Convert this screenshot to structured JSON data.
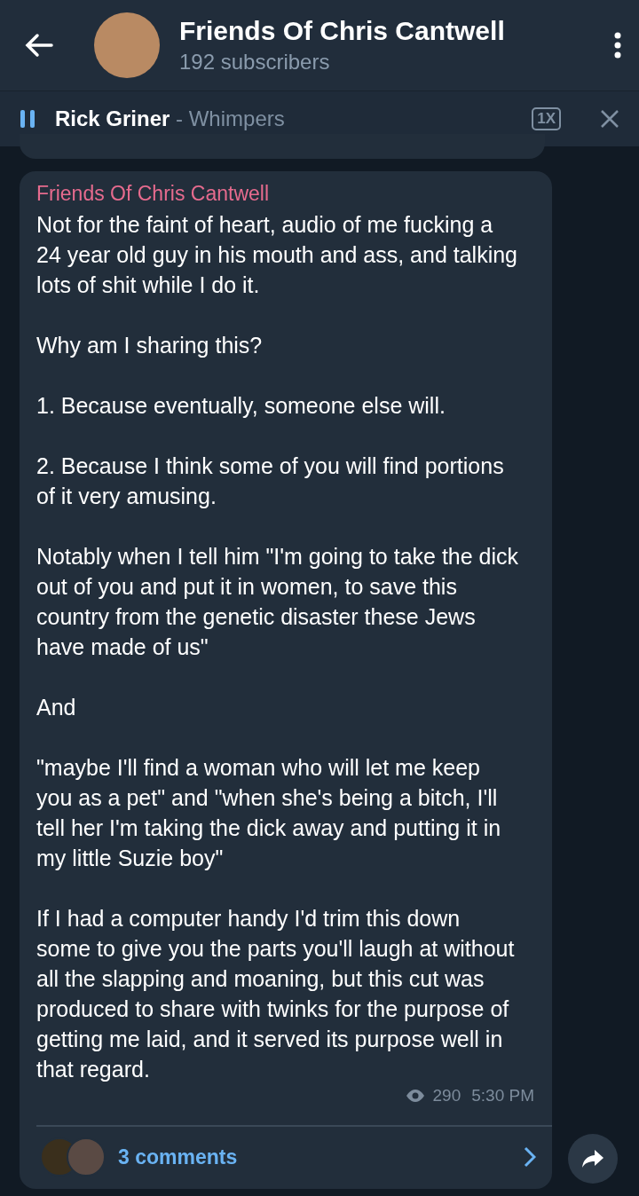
{
  "header": {
    "title": "Friends Of Chris Cantwell",
    "subtitle": "192 subscribers"
  },
  "player": {
    "playing": true,
    "artist": "Rick Griner",
    "track": " - Whimpers",
    "speed": "1X"
  },
  "post": {
    "author": "Friends Of Chris Cantwell",
    "paragraphs": [
      "Not for the faint of heart, audio of me fucking a 24 year old guy in his mouth and ass, and talking lots of shit while I do it.",
      "Why am I sharing this?",
      "1. Because eventually, someone else will.",
      "2. Because I think some of you will find portions of it very amusing.",
      "Notably when I tell him \"I'm going to take the dick out of you and put it in women, to save this country from the genetic disaster these Jews have made of us\"",
      "And",
      "\"maybe I'll find a woman who will let me keep you as a pet\" and \"when she's being a bitch, I'll tell her I'm taking the dick away and putting it in my little Suzie boy\"",
      "If I had a computer handy I'd trim this down some to give you the parts you'll laugh at without all the slapping and moaning, but this cut was produced to share with twinks for the purpose of getting me laid, and it served its purpose well in that regard."
    ],
    "views": "290",
    "time": "5:30 PM",
    "comments": "3 comments"
  }
}
